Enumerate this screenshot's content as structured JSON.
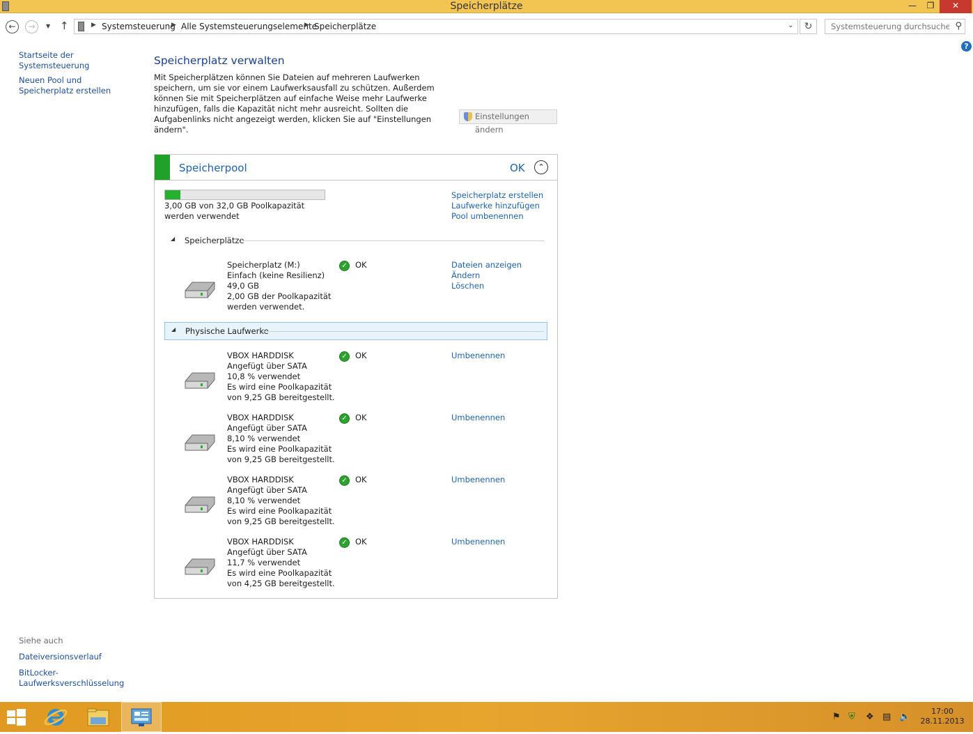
{
  "window": {
    "title": "Speicherplätze",
    "minimize": "—",
    "restore": "❐",
    "close": "✕"
  },
  "nav": {
    "breadcrumbs": [
      "Systemsteuerung",
      "Alle Systemsteuerungselemente",
      "Speicherplätze"
    ],
    "search_placeholder": "Systemsteuerung durchsuchen"
  },
  "sidebar": {
    "links": [
      "Startseite der Systemsteuerung",
      "Neuen Pool und Speicherplatz erstellen"
    ],
    "see_also_title": "Siehe auch",
    "see_also": [
      "Dateiversionsverlauf",
      "BitLocker-Laufwerksverschlüsselung"
    ]
  },
  "main": {
    "heading": "Speicherplatz verwalten",
    "intro": "Mit Speicherplätzen können Sie Dateien auf mehreren Laufwerken speichern, um sie vor einem Laufwerksausfall zu schützen. Außerdem können Sie mit Speicherplätzen auf einfache Weise mehr Laufwerke hinzufügen, falls die Kapazität nicht mehr ausreicht. Sollten die Aufgabenlinks nicht angezeigt werden, klicken Sie auf \"Einstellungen ändern\".",
    "settings_button": "Einstellungen ändern"
  },
  "pool": {
    "title": "Speicherpool",
    "status": "OK",
    "usage_fraction": 0.094,
    "usage_text": "3,00 GB von 32,0 GB Poolkapazität werden verwendet",
    "links": [
      "Speicherplatz erstellen",
      "Laufwerke hinzufügen",
      "Pool umbenennen"
    ],
    "spaces_section": "Speicherplätze",
    "space": {
      "lines": [
        "Speicherplatz (M:)",
        "Einfach (keine Resilienz)",
        "49,0 GB",
        "2,00 GB der Poolkapazität werden verwendet."
      ],
      "status": "OK",
      "links": [
        "Dateien anzeigen",
        "Ändern",
        "Löschen"
      ]
    },
    "drives_section": "Physische Laufwerke",
    "drives": [
      {
        "lines": [
          "VBOX HARDDISK",
          "Angefügt über SATA",
          "10,8 % verwendet",
          "Es wird eine Poolkapazität von 9,25 GB bereitgestellt."
        ],
        "status": "OK",
        "link": "Umbenennen"
      },
      {
        "lines": [
          "VBOX HARDDISK",
          "Angefügt über SATA",
          "8,10 % verwendet",
          "Es wird eine Poolkapazität von 9,25 GB bereitgestellt."
        ],
        "status": "OK",
        "link": "Umbenennen"
      },
      {
        "lines": [
          "VBOX HARDDISK",
          "Angefügt über SATA",
          "8,10 % verwendet",
          "Es wird eine Poolkapazität von 9,25 GB bereitgestellt."
        ],
        "status": "OK",
        "link": "Umbenennen"
      },
      {
        "lines": [
          "VBOX HARDDISK",
          "Angefügt über SATA",
          "11,7 % verwendet",
          "Es wird eine Poolkapazität von 4,25 GB bereitgestellt."
        ],
        "status": "OK",
        "link": "Umbenennen"
      }
    ]
  },
  "taskbar": {
    "time": "17:00",
    "date": "28.11.2013"
  },
  "colors": {
    "titlebar": "#f2c553",
    "link": "#1e64b0",
    "heading": "#1b3f8f",
    "pool_green": "#1fa12a",
    "taskbar": "#e19a21"
  }
}
